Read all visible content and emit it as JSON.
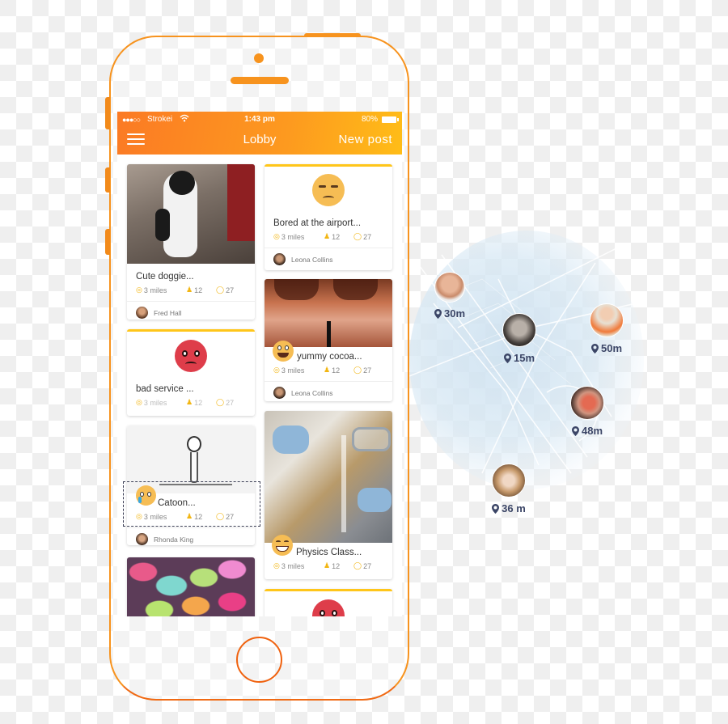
{
  "status_bar": {
    "signal": "●●●○○",
    "carrier": "Strokei",
    "wifi_icon": "wifi-icon",
    "time": "1:43 pm",
    "battery": "80%"
  },
  "app_bar": {
    "menu_icon": "hamburger-menu-icon",
    "title": "Lobby",
    "action": "New post"
  },
  "colors": {
    "brand_orange": "#f7931e",
    "appbar_start": "#fb7a24",
    "appbar_end": "#ffbd17",
    "card_accent": "#ffc61a",
    "metric_icon": "#f2b614",
    "map_label": "#3b4566"
  },
  "posts": [
    {
      "caption": "Cute doggie...",
      "distance": "3 miles",
      "people": "12",
      "comments": "27",
      "author": "Fred Hall",
      "media": "photo-puppy"
    },
    {
      "caption": "Bored at the airport...",
      "distance": "3 miles",
      "people": "12",
      "comments": "27",
      "author": "Leona Collins",
      "media": "emoji-unamused"
    },
    {
      "caption": "bad service ...",
      "distance": "3 miles",
      "people": "12",
      "comments": "27",
      "media": "emoji-angry"
    },
    {
      "caption": "yummy cocoa...",
      "distance": "3 miles",
      "people": "12",
      "comments": "27",
      "author": "Leona Collins",
      "media": "photo-cocoa",
      "emoji": "grinning-emoji"
    },
    {
      "caption": "Catoon...",
      "distance": "3 miles",
      "people": "12",
      "comments": "27",
      "author": "Rhonda King",
      "media": "sketch-cartoon",
      "emoji": "crying-emoji"
    },
    {
      "caption": "Physics Class...",
      "distance": "3 miles",
      "people": "12",
      "comments": "27",
      "media": "photo-lab",
      "emoji": "smiling-emoji"
    },
    {
      "media": "photo-candies"
    },
    {
      "media": "emoji-angry"
    }
  ],
  "nearby": [
    {
      "distance": "30m"
    },
    {
      "distance": "15m"
    },
    {
      "distance": "50m"
    },
    {
      "distance": "48m"
    },
    {
      "distance": "36 m"
    }
  ]
}
